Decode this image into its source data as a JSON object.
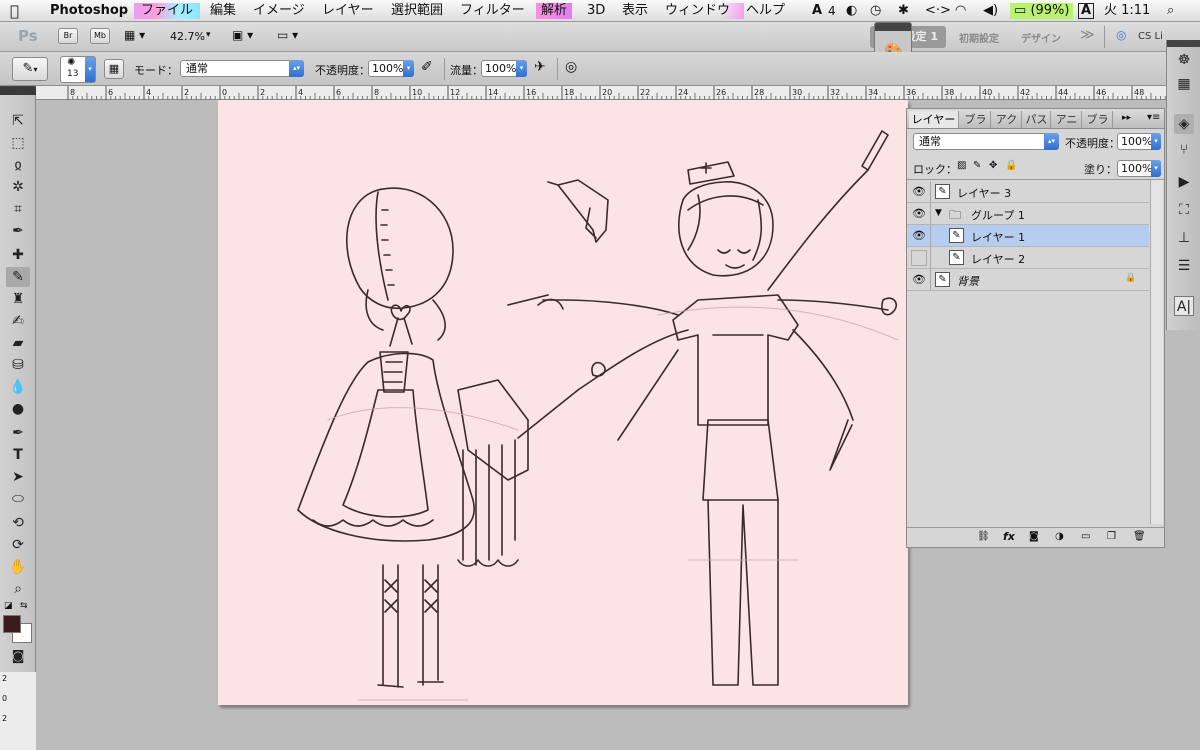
{
  "menubar": {
    "apple": "",
    "app": "Photoshop",
    "items": [
      "ファイル",
      "編集",
      "イメージ",
      "レイヤー",
      "選択範囲",
      "フィルター",
      "解析",
      "3D",
      "表示",
      "ウィンドウ",
      "ヘルプ"
    ],
    "status": {
      "adobe_count": "4",
      "battery": "(99%)",
      "clock": "火 1:11"
    }
  },
  "appbar": {
    "logo": "Ps",
    "br": "Br",
    "mb": "Mb",
    "zoom": "42.7%",
    "workspaces": [
      "設定 1",
      "初期設定",
      "デザイン"
    ],
    "more": "≫",
    "cs_live": "CS Li"
  },
  "options": {
    "brush_size": "13",
    "mode_label": "モード：",
    "mode_value": "通常",
    "opacity_label": "不透明度：",
    "opacity_value": "100%",
    "flow_label": "流量：",
    "flow_value": "100%"
  },
  "ruler": {
    "h_labels": [
      "8",
      "6",
      "4",
      "2",
      "0",
      "2",
      "4",
      "6",
      "8",
      "10",
      "12",
      "14",
      "16",
      "18",
      "20",
      "22",
      "24",
      "26",
      "28",
      "30",
      "32",
      "34",
      "36",
      "38",
      "40",
      "42",
      "44",
      "46",
      "48"
    ],
    "v_labels": [
      "2",
      "0",
      "2"
    ]
  },
  "layers_panel": {
    "tabs": [
      "レイヤー",
      "ブラ",
      "アク",
      "パス",
      "アニ",
      "ブラ"
    ],
    "blend_mode": "通常",
    "opacity_label": "不透明度：",
    "opacity_value": "100%",
    "lock_label": "ロック：",
    "fill_label": "塗り：",
    "fill_value": "100%",
    "layers": [
      {
        "name": "レイヤー 3",
        "visible": true,
        "type": "layer",
        "indent": 0,
        "selected": false
      },
      {
        "name": "グループ 1",
        "visible": true,
        "type": "group",
        "indent": 0,
        "selected": false
      },
      {
        "name": "レイヤー 1",
        "visible": true,
        "type": "layer",
        "indent": 1,
        "selected": true
      },
      {
        "name": "レイヤー 2",
        "visible": false,
        "type": "layer",
        "indent": 1,
        "selected": false
      },
      {
        "name": "背景",
        "visible": true,
        "type": "background",
        "indent": 0,
        "selected": false
      }
    ],
    "footer_icons": [
      "link-icon",
      "fx-icon",
      "mask-icon",
      "adjustment-icon",
      "folder-icon",
      "new-layer-icon",
      "trash-icon"
    ]
  },
  "colors": {
    "canvas": "#fbe3e6",
    "sketch": "#3a2a2c",
    "selected_row": "#b7cdef",
    "foreground_swatch": "#3d1a1e"
  }
}
